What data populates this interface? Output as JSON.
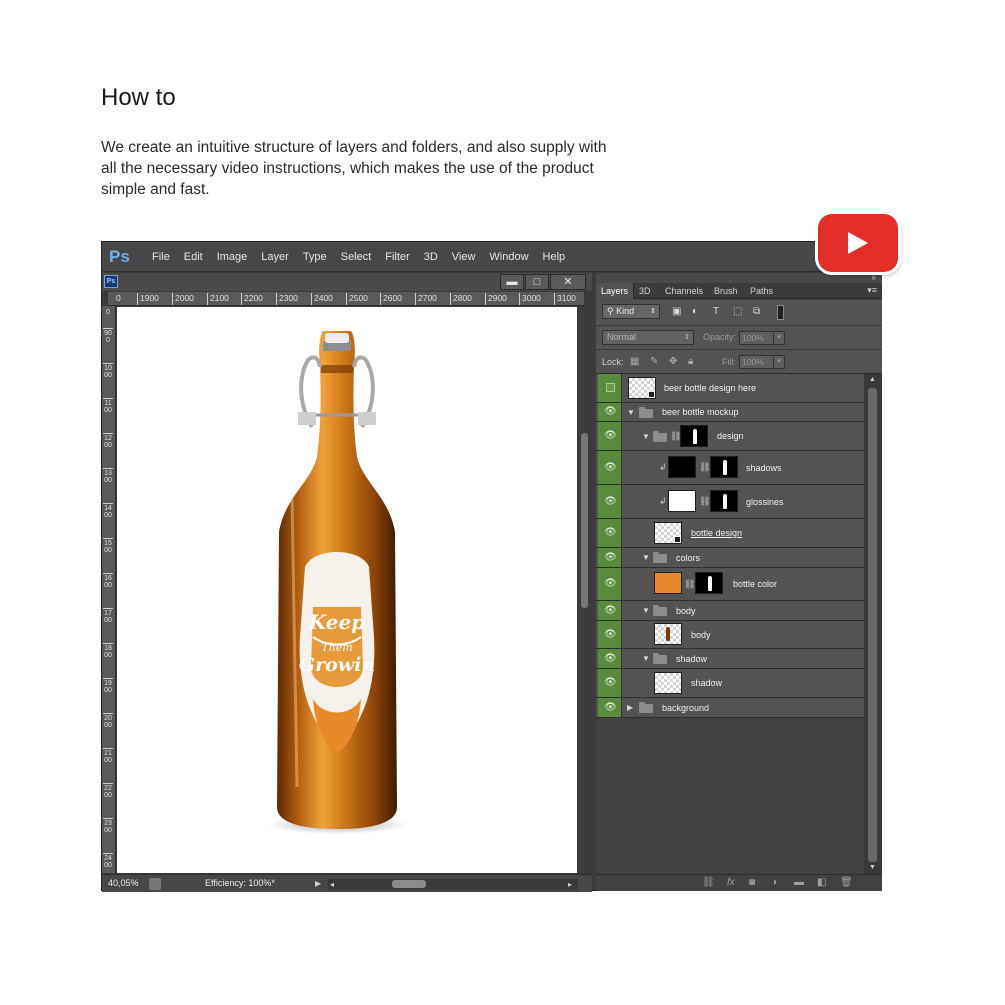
{
  "heading": "How to",
  "intro": "We create an intuitive structure of layers and folders, and also supply with all the necessary video instructions, which makes the use of the product simple and fast.",
  "colors": {
    "youtube_red": "#e52d27",
    "layer_eye_green": "#5a8a3c",
    "ps_blue": "#6fb0e6",
    "bottle_color": "#e8892c"
  },
  "photoshop": {
    "logo": "Ps",
    "menu": [
      "File",
      "Edit",
      "Image",
      "Layer",
      "Type",
      "Select",
      "Filter",
      "3D",
      "View",
      "Window",
      "Help"
    ],
    "doc_icon": "Ps",
    "window_buttons": {
      "minimize": "▬",
      "restore": "□",
      "close": "✕"
    },
    "ruler_top": [
      "1900",
      "2000",
      "2100",
      "2200",
      "2300",
      "2400",
      "2500",
      "2600",
      "2700",
      "2800",
      "2900",
      "3000",
      "3100"
    ],
    "ruler_left": [
      "900",
      "1000",
      "1100",
      "1200",
      "1300",
      "1400",
      "1500",
      "1600",
      "1700",
      "1800",
      "1900",
      "2000",
      "2100",
      "2200",
      "2300",
      "2400"
    ],
    "status": {
      "zoom": "40,05%",
      "efficiency": "Efficiency: 100%*"
    },
    "canvas_art": {
      "line1": "Keep",
      "line2": "Them",
      "line3": "Growin"
    }
  },
  "layers_panel": {
    "tabs": [
      "Layers",
      "3D",
      "Channels",
      "Brush",
      "Paths"
    ],
    "filter_kind": "Kind",
    "blend_mode": "Normal",
    "opacity_label": "Opacity:",
    "opacity_value": "100%",
    "lock_label": "Lock:",
    "fill_label": "Fill:",
    "fill_value": "100%",
    "layers": [
      {
        "name": "beer bottle design here"
      },
      {
        "name": "beer bottle mockup"
      },
      {
        "name": "design"
      },
      {
        "name": "shadows"
      },
      {
        "name": "glossines"
      },
      {
        "name": "bottle design"
      },
      {
        "name": "colors"
      },
      {
        "name": "bottle color"
      },
      {
        "name": "body"
      },
      {
        "name": "body"
      },
      {
        "name": "shadow"
      },
      {
        "name": "shadow"
      },
      {
        "name": "background"
      }
    ]
  }
}
